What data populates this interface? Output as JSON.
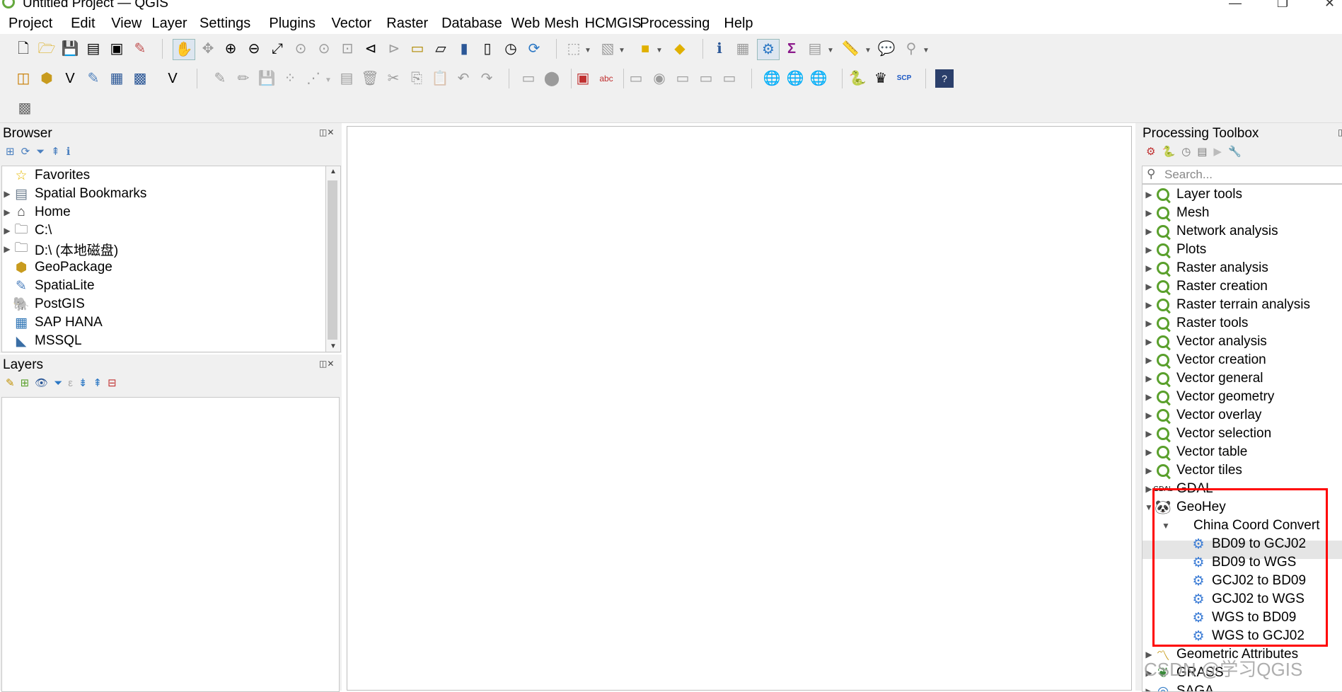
{
  "window": {
    "title": "Untitled Project — QGIS"
  },
  "menu": [
    "Project",
    "Edit",
    "View",
    "Layer",
    "Settings",
    "Plugins",
    "Vector",
    "Raster",
    "Database",
    "Web",
    "Mesh",
    "HCMGIS",
    "Processing",
    "Help"
  ],
  "browser": {
    "title": "Browser",
    "items": [
      {
        "label": "Favorites",
        "icon": "star-icon",
        "glyph": "☆",
        "color": "#e6b800",
        "expandable": false
      },
      {
        "label": "Spatial Bookmarks",
        "icon": "bookmark-icon",
        "glyph": "▤",
        "color": "#6b7b8c",
        "expandable": true
      },
      {
        "label": "Home",
        "icon": "home-icon",
        "glyph": "⌂",
        "color": "#333333",
        "expandable": true
      },
      {
        "label": "C:\\",
        "icon": "folder-icon",
        "glyph": "🗀",
        "color": "#555555",
        "expandable": true
      },
      {
        "label": "D:\\ (本地磁盘)",
        "icon": "folder-icon",
        "glyph": "🗀",
        "color": "#555555",
        "expandable": true
      },
      {
        "label": "GeoPackage",
        "icon": "geopackage-icon",
        "glyph": "⬢",
        "color": "#c89b1e",
        "expandable": false
      },
      {
        "label": "SpatiaLite",
        "icon": "feather-icon",
        "glyph": "✎",
        "color": "#4f81bd",
        "expandable": false
      },
      {
        "label": "PostGIS",
        "icon": "elephant-icon",
        "glyph": "🐘",
        "color": "#4f6f9f",
        "expandable": false
      },
      {
        "label": "SAP HANA",
        "icon": "sap-hana-icon",
        "glyph": "▦",
        "color": "#2f75b5",
        "expandable": false
      },
      {
        "label": "MSSQL",
        "icon": "mssql-icon",
        "glyph": "◣",
        "color": "#3a6ea5",
        "expandable": false
      }
    ]
  },
  "layers": {
    "title": "Layers"
  },
  "toolbox": {
    "title": "Processing Toolbox",
    "search_placeholder": "Search...",
    "groups": [
      "Layer tools",
      "Mesh",
      "Network analysis",
      "Plots",
      "Raster analysis",
      "Raster creation",
      "Raster terrain analysis",
      "Raster tools",
      "Vector analysis",
      "Vector creation",
      "Vector general",
      "Vector geometry",
      "Vector overlay",
      "Vector selection",
      "Vector table",
      "Vector tiles"
    ],
    "gdal": "GDAL",
    "geohey": "GeoHey",
    "china": "China Coord Convert",
    "algorithms": [
      "BD09 to GCJ02",
      "BD09 to WGS",
      "GCJ02 to BD09",
      "GCJ02 to WGS",
      "WGS to BD09",
      "WGS to GCJ02"
    ],
    "more": [
      "Geometric Attributes",
      "GRASS",
      "SAGA"
    ],
    "highlight_color": "#ff0000"
  },
  "watermark": "CSDN @学习QGIS"
}
